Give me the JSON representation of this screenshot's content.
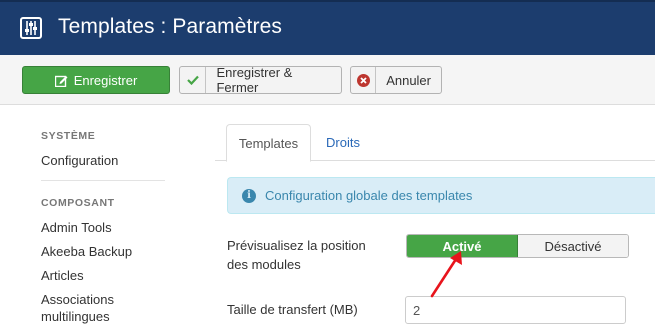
{
  "header": {
    "title": "Templates : Paramètres",
    "icon": "sliders-icon"
  },
  "toolbar": {
    "save_label": "Enregistrer",
    "save_close_label": "Enregistrer & Fermer",
    "cancel_label": "Annuler",
    "save_color": "#46a546"
  },
  "sidebar": {
    "sections": [
      {
        "heading": "SYSTÈME",
        "items": [
          "Configuration"
        ]
      },
      {
        "heading": "COMPOSANT",
        "items": [
          "Admin Tools",
          "Akeeba Backup",
          "Articles",
          "Associations multilingues"
        ]
      }
    ]
  },
  "tabs": [
    {
      "label": "Templates",
      "active": true
    },
    {
      "label": "Droits",
      "active": false
    }
  ],
  "info": {
    "text": "Configuration globale des templates",
    "icon": "info-icon"
  },
  "form": {
    "preview_label_line1": "Prévisualisez la position",
    "preview_label_line2": "des modules",
    "toggle_on": "Activé",
    "toggle_off": "Désactivé",
    "transfer_label": "Taille de transfert (MB)",
    "transfer_value": "2"
  },
  "annotation": {
    "color": "#e8141c",
    "icon": "red-arrow"
  }
}
